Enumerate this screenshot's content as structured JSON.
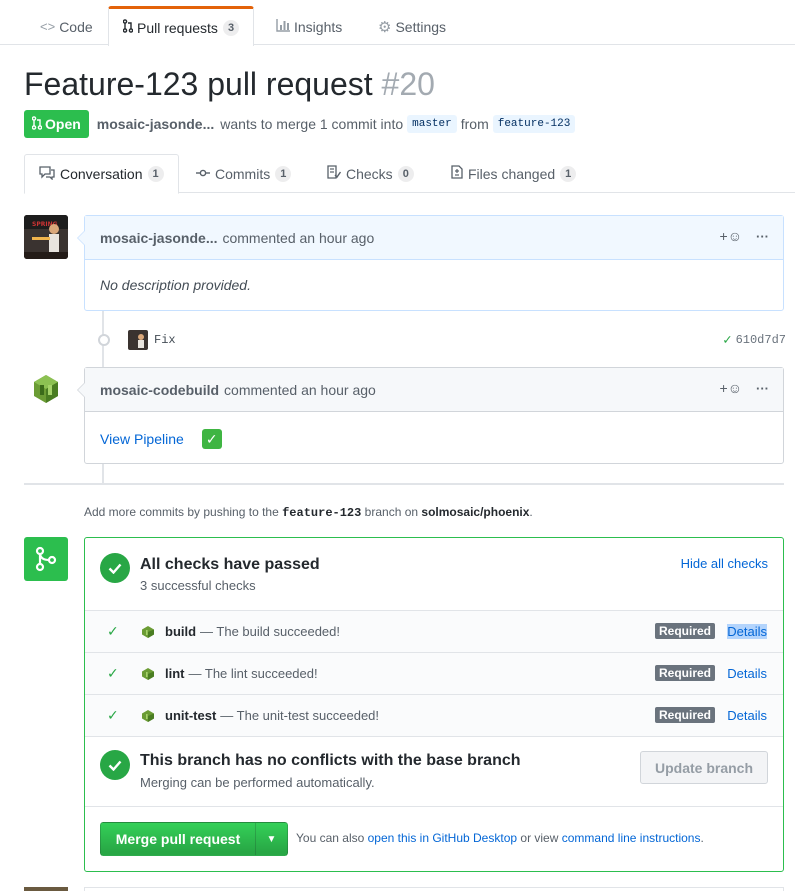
{
  "repo_nav": {
    "tabs": [
      {
        "label": "Code",
        "icon": "code-icon"
      },
      {
        "label": "Pull requests",
        "icon": "pull-request-icon",
        "count": "3"
      },
      {
        "label": "Insights",
        "icon": "graph-icon"
      },
      {
        "label": "Settings",
        "icon": "gear-icon"
      }
    ]
  },
  "pr": {
    "title": "Feature-123 pull request",
    "number": "#20",
    "state": "Open",
    "author": "mosaic-jasonde...",
    "merge_text": "wants to merge 1 commit into",
    "base_branch": "master",
    "from_text": "from",
    "head_branch": "feature-123"
  },
  "pr_tabs": [
    {
      "label": "Conversation",
      "count": "1",
      "icon": "comment-discussion-icon"
    },
    {
      "label": "Commits",
      "count": "1",
      "icon": "git-commit-icon"
    },
    {
      "label": "Checks",
      "count": "0",
      "icon": "checklist-icon"
    },
    {
      "label": "Files changed",
      "count": "1",
      "icon": "file-diff-icon"
    }
  ],
  "comments": [
    {
      "author": "mosaic-jasonde...",
      "action": "commented an hour ago",
      "body": "No description provided."
    },
    {
      "author": "mosaic-codebuild",
      "action": "commented an hour ago",
      "body_link": "View Pipeline",
      "body_emoji": "✅"
    }
  ],
  "commit": {
    "message": "Fix",
    "sha": "610d7d7"
  },
  "comment_actions": {
    "reaction": "+☺",
    "more": "···"
  },
  "hint": {
    "prefix": "Add more commits by pushing to the",
    "branch": "feature-123",
    "middle": "branch on",
    "repo": "solmosaic/phoenix",
    "suffix": "."
  },
  "merge_box": {
    "checks_title": "All checks have passed",
    "checks_sub": "3 successful checks",
    "hide_checks": "Hide all checks",
    "checks": [
      {
        "name": "build",
        "desc": "— The build succeeded!",
        "required": "Required",
        "details": "Details"
      },
      {
        "name": "lint",
        "desc": "— The lint succeeded!",
        "required": "Required",
        "details": "Details"
      },
      {
        "name": "unit-test",
        "desc": "— The unit-test succeeded!",
        "required": "Required",
        "details": "Details"
      }
    ],
    "conflicts_title": "This branch has no conflicts with the base branch",
    "conflicts_sub": "Merging can be performed automatically.",
    "update_branch": "Update branch",
    "merge_button": "Merge pull request",
    "alt_prefix": "You can also",
    "alt_link1": "open this in GitHub Desktop",
    "alt_middle": "or view",
    "alt_link2": "command line instructions",
    "alt_suffix": "."
  },
  "colors": {
    "accent": "#2cbe4e",
    "link": "#0366d6",
    "tab_highlight": "#e36209"
  }
}
